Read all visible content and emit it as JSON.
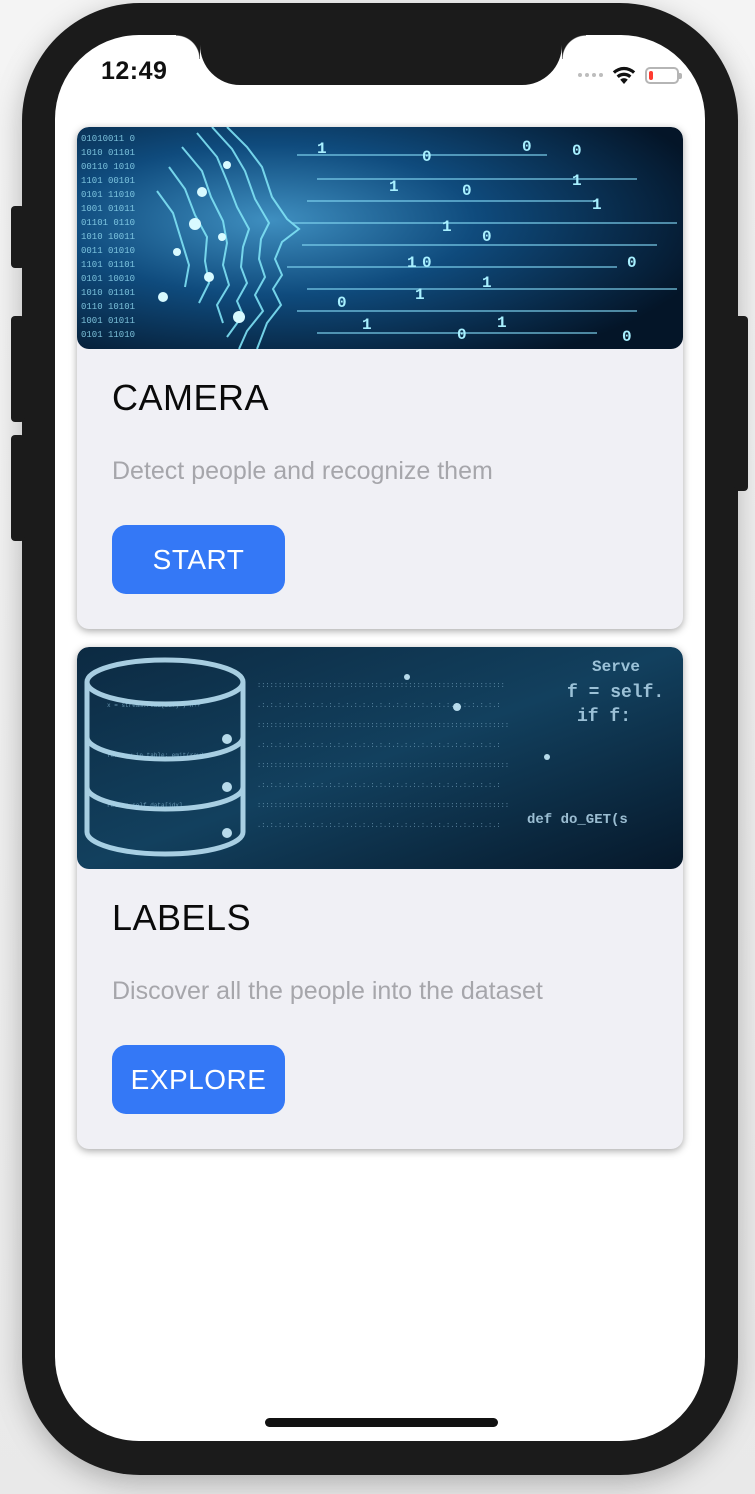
{
  "status_bar": {
    "time": "12:49",
    "battery_level": 0.15,
    "battery_color": "#ff3b30"
  },
  "theme": {
    "accent": "#3478f6",
    "card_background": "#f0f0f5",
    "description_color": "#a6a6ab"
  },
  "cards": [
    {
      "image_icon": "ai-face-circuit-image",
      "title": "CAMERA",
      "description": "Detect people and recognize them",
      "button_label": "START"
    },
    {
      "image_icon": "database-code-image",
      "title": "LABELS",
      "description": "Discover all the people into the dataset",
      "button_label": "EXPLORE"
    }
  ]
}
